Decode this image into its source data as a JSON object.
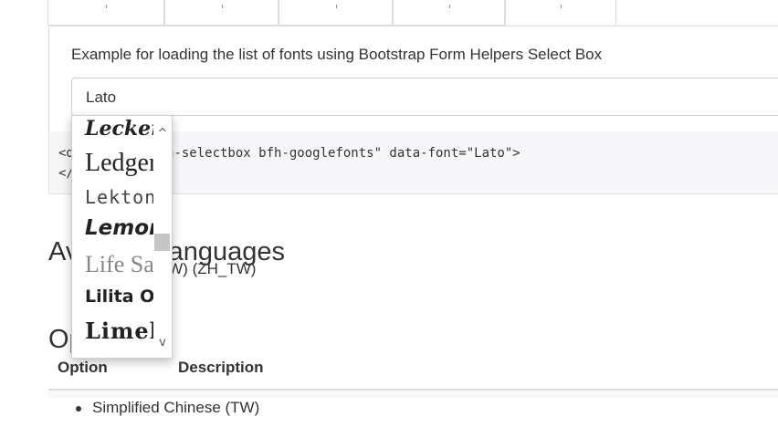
{
  "page": {
    "example_text": "Example for loading the list of fonts using Bootstrap Form Helpers Select Box",
    "selectbox": {
      "value": "Lato"
    },
    "code": {
      "line1": "<div class=\"bfh-selectbox bfh-googlefonts\" data-font=\"Lato\">",
      "line2": "</div>"
    },
    "languages_heading": "Available languages",
    "languages_text": "Chinese (TW) (ZH_TW)",
    "options_heading": "Options",
    "table": {
      "headers": [
        "Option",
        "Description"
      ]
    },
    "list_items": [
      "Simplified Chinese (TW)"
    ]
  },
  "dropdown": {
    "items": [
      "Leckerli One",
      "Ledger",
      "Lekton",
      "Lemon",
      "Life Savers",
      "Lilita One",
      "Limelight"
    ],
    "scroll_up_icon": "chevron-up-icon",
    "scroll_down_icon": "chevron-down-icon",
    "scroll_up_glyph": "^",
    "scroll_down_glyph": "v",
    "scroll_position": 0.5
  },
  "colors": {
    "border": "#dddddd",
    "code_bg": "#f7f7f9",
    "tab_tick": "#6b8fd0",
    "scroll_thumb": "#c6c6c6"
  }
}
